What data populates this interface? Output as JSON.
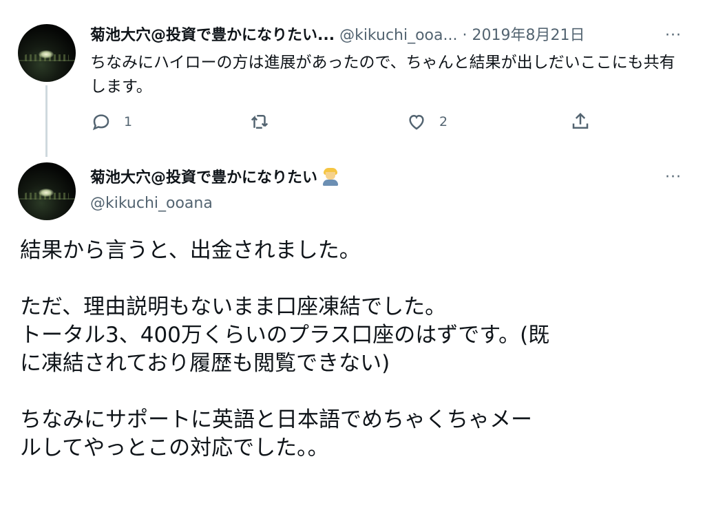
{
  "reply_tweet": {
    "display_name": "菊池大穴@投資で豊かになりたい...",
    "handle": "@kikuchi_ooa...",
    "separator": "·",
    "date": "2019年8月21日",
    "more": "···",
    "text": "ちなみにハイローの方は進展があったので、ちゃんと結果が出しだいここにも共有します。",
    "actions": {
      "reply_count": "1",
      "retweet_count": "",
      "like_count": "2"
    }
  },
  "main_tweet": {
    "display_name": "菊池大穴@投資で豊かになりたい",
    "handle": "@kikuchi_ooana",
    "more": "···",
    "lines": [
      "結果から言うと、出金されました。",
      "",
      "ただ、理由説明もないまま口座凍結でした。",
      "トータル3、400万くらいのプラス口座のはずです。(既",
      "に凍結されており履歴も閲覧できない)",
      "",
      "ちなみにサポートに英語と日本語でめちゃくちゃメー",
      "ルしてやっとこの対応でした。。"
    ]
  },
  "icons": {
    "avatar": "profile-photo-night-city",
    "reply": "speech-bubble-icon",
    "retweet": "retweet-arrows-icon",
    "like": "heart-icon",
    "share": "share-upload-icon",
    "emoji": "blond-person-emoji"
  },
  "colors": {
    "text": "#0f1419",
    "muted": "#536471",
    "thread_line": "#cfd9de",
    "background": "#ffffff"
  }
}
